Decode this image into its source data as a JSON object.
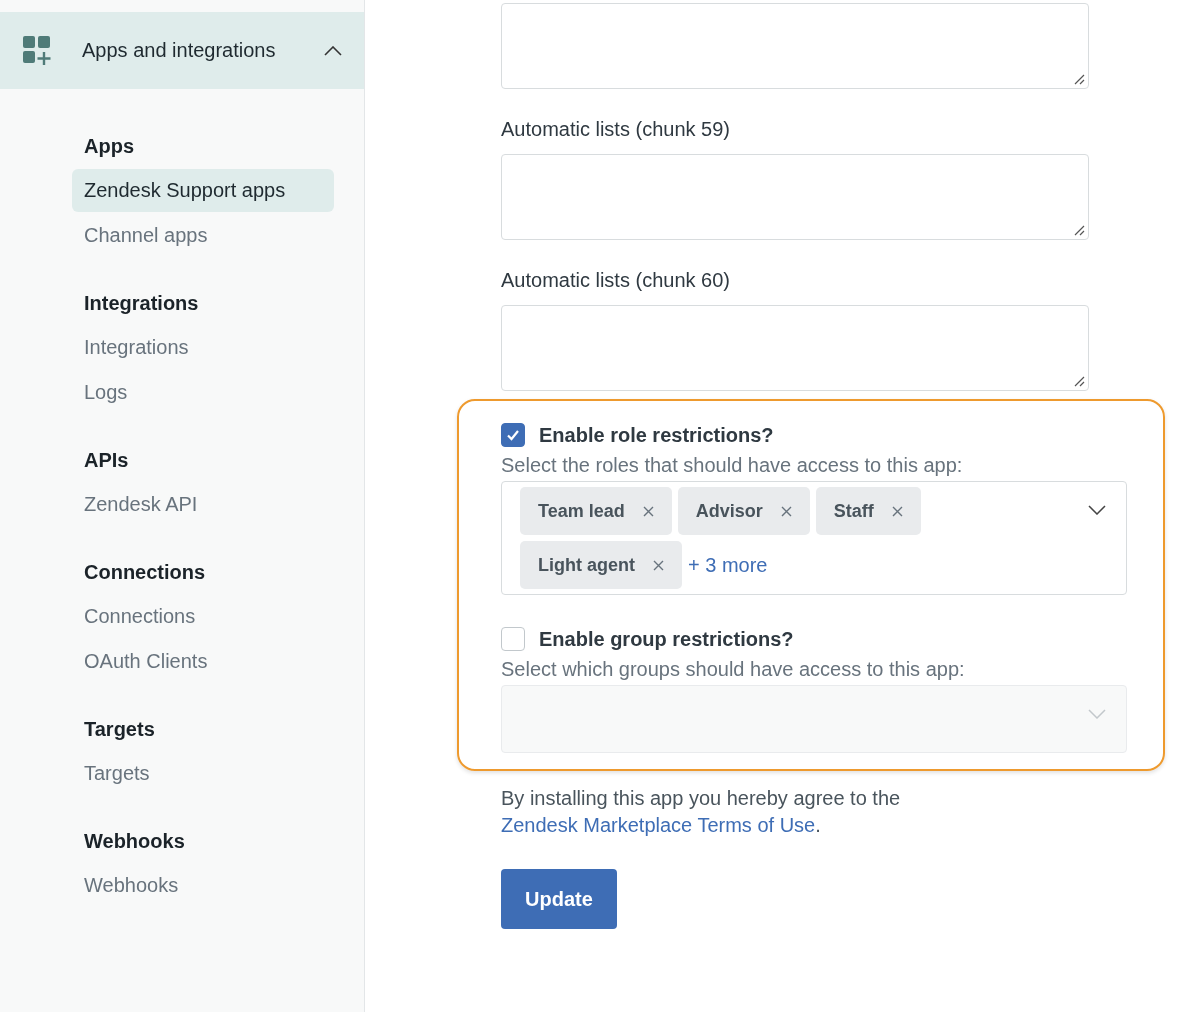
{
  "sidebar": {
    "section": {
      "title": "Apps and integrations",
      "expanded": true
    },
    "groups": [
      {
        "heading": "Apps",
        "items": [
          {
            "label": "Zendesk Support apps",
            "selected": true
          },
          {
            "label": "Channel apps",
            "selected": false
          }
        ]
      },
      {
        "heading": "Integrations",
        "items": [
          {
            "label": "Integrations",
            "selected": false
          },
          {
            "label": "Logs",
            "selected": false
          }
        ]
      },
      {
        "heading": "APIs",
        "items": [
          {
            "label": "Zendesk API",
            "selected": false
          }
        ]
      },
      {
        "heading": "Connections",
        "items": [
          {
            "label": "Connections",
            "selected": false
          },
          {
            "label": "OAuth Clients",
            "selected": false
          }
        ]
      },
      {
        "heading": "Targets",
        "items": [
          {
            "label": "Targets",
            "selected": false
          }
        ]
      },
      {
        "heading": "Webhooks",
        "items": [
          {
            "label": "Webhooks",
            "selected": false
          }
        ]
      }
    ]
  },
  "fields": [
    {
      "kind": "textarea"
    },
    {
      "kind": "textarea",
      "label": "Automatic lists (chunk 59)"
    },
    {
      "kind": "textarea",
      "label": "Automatic lists (chunk 60)"
    }
  ],
  "restrictions": [
    {
      "label": "Enable role restrictions?",
      "checked": true,
      "hint": "Select the roles that should have access to this app:",
      "disabled": false,
      "tags": [
        "Team lead",
        "Advisor",
        "Staff",
        "Light agent"
      ],
      "more": "+ 3 more"
    },
    {
      "label": "Enable group restrictions?",
      "checked": false,
      "hint": "Select which groups should have access to this app:",
      "disabled": true
    }
  ],
  "consent": {
    "text": "By installing this app you hereby agree to the",
    "link": "Zendesk Marketplace Terms of Use",
    "suffix": "."
  },
  "button": "Update"
}
